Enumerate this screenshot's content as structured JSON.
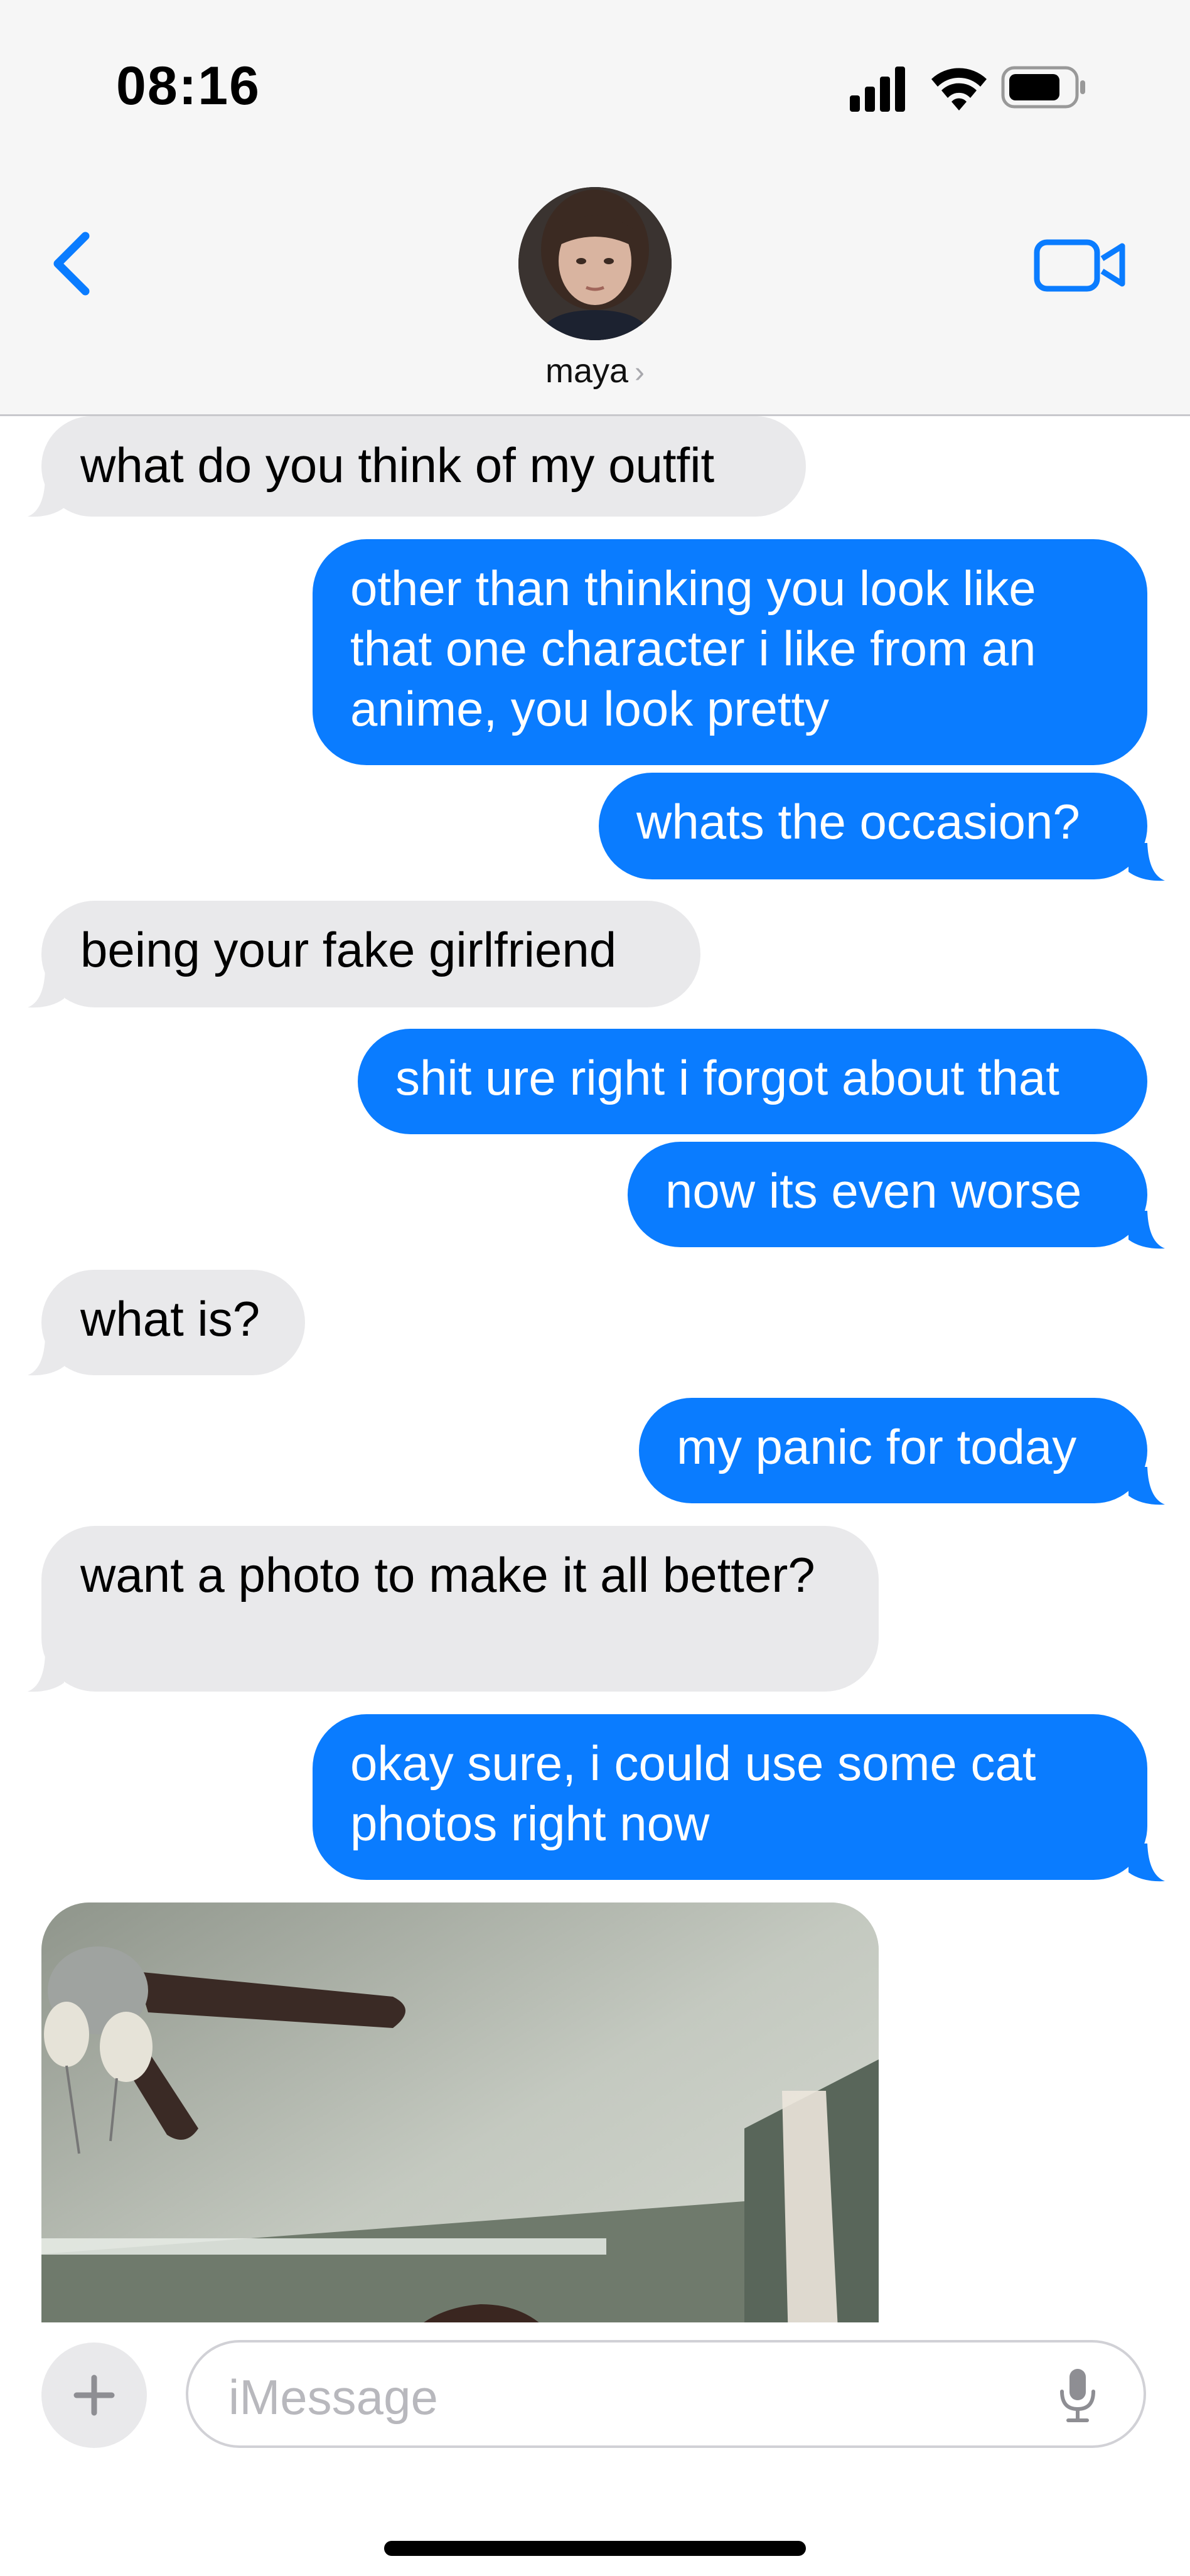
{
  "status_bar": {
    "time": "08:16",
    "icons": [
      "signal-icon",
      "wifi-icon",
      "battery-icon"
    ]
  },
  "header": {
    "contact_name": "maya",
    "contact_chevron": "›",
    "back_icon": "chevron-left-icon",
    "video_icon": "video-camera-icon"
  },
  "messages": [
    {
      "direction": "incoming",
      "text": "what do you think of my outfit"
    },
    {
      "direction": "outgoing",
      "text": "other than thinking you look like that one character i like from an anime, you look pretty"
    },
    {
      "direction": "outgoing",
      "text": "whats the occasion?"
    },
    {
      "direction": "incoming",
      "text": "being your fake girlfriend"
    },
    {
      "direction": "outgoing",
      "text": "shit ure right i forgot about that"
    },
    {
      "direction": "outgoing",
      "text": "now its even worse"
    },
    {
      "direction": "incoming",
      "text": "what is?"
    },
    {
      "direction": "outgoing",
      "text": "my panic for today"
    },
    {
      "direction": "incoming",
      "text": "want a photo to make it all better?"
    },
    {
      "direction": "outgoing",
      "text": "okay sure, i could use some cat photos right now"
    }
  ],
  "photo_message": {
    "direction": "incoming"
  },
  "composer": {
    "placeholder": "iMessage",
    "plus_label": "+",
    "mic_icon": "microphone-icon"
  },
  "colors": {
    "incoming_bubble": "#e9e9eb",
    "outgoing_bubble": "#0a7cff",
    "accent": "#0a7cff"
  }
}
